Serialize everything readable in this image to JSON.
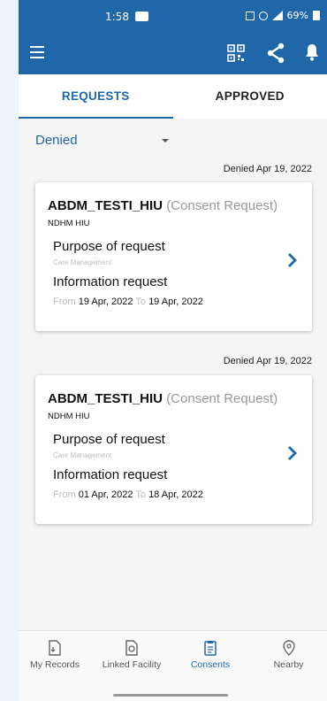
{
  "status_bar": {
    "time": "1:58",
    "battery_text": "69%"
  },
  "toolbar": {
    "icons": [
      "menu-icon",
      "qr-code-icon",
      "share-icon",
      "bell-icon"
    ]
  },
  "tabs": [
    {
      "label": "REQUESTS",
      "active": true
    },
    {
      "label": "APPROVED",
      "active": false
    }
  ],
  "filter": {
    "selected": "Denied"
  },
  "requests": [
    {
      "status_date": "Denied Apr 19, 2022",
      "requester": "ABDM_TESTI_HIU",
      "request_type": "(Consent Request)",
      "hiu_name": "NDHM HIU",
      "purpose_label": "Purpose of request",
      "purpose_value": "Care Management",
      "info_label": "Information request",
      "from_label": "From",
      "from_date": "19 Apr, 2022",
      "to_label": "To",
      "to_date": "19 Apr, 2022"
    },
    {
      "status_date": "Denied Apr 19, 2022",
      "requester": "ABDM_TESTI_HIU",
      "request_type": "(Consent Request)",
      "hiu_name": "NDHM HIU",
      "purpose_label": "Purpose of request",
      "purpose_value": "Care Management",
      "info_label": "Information request",
      "from_label": "From",
      "from_date": "01 Apr, 2022",
      "to_label": "To",
      "to_date": "18 Apr, 2022"
    }
  ],
  "bottom_nav": [
    {
      "label": "My Records",
      "icon": "records-icon",
      "active": false
    },
    {
      "label": "Linked Facility",
      "icon": "linked-facility-icon",
      "active": false
    },
    {
      "label": "Consents",
      "icon": "consents-icon",
      "active": true
    },
    {
      "label": "Nearby",
      "icon": "location-pin-icon",
      "active": false
    }
  ],
  "colors": {
    "primary": "#1f67a9",
    "muted_text": "#bbbbbb",
    "background": "#f5f5f5"
  }
}
